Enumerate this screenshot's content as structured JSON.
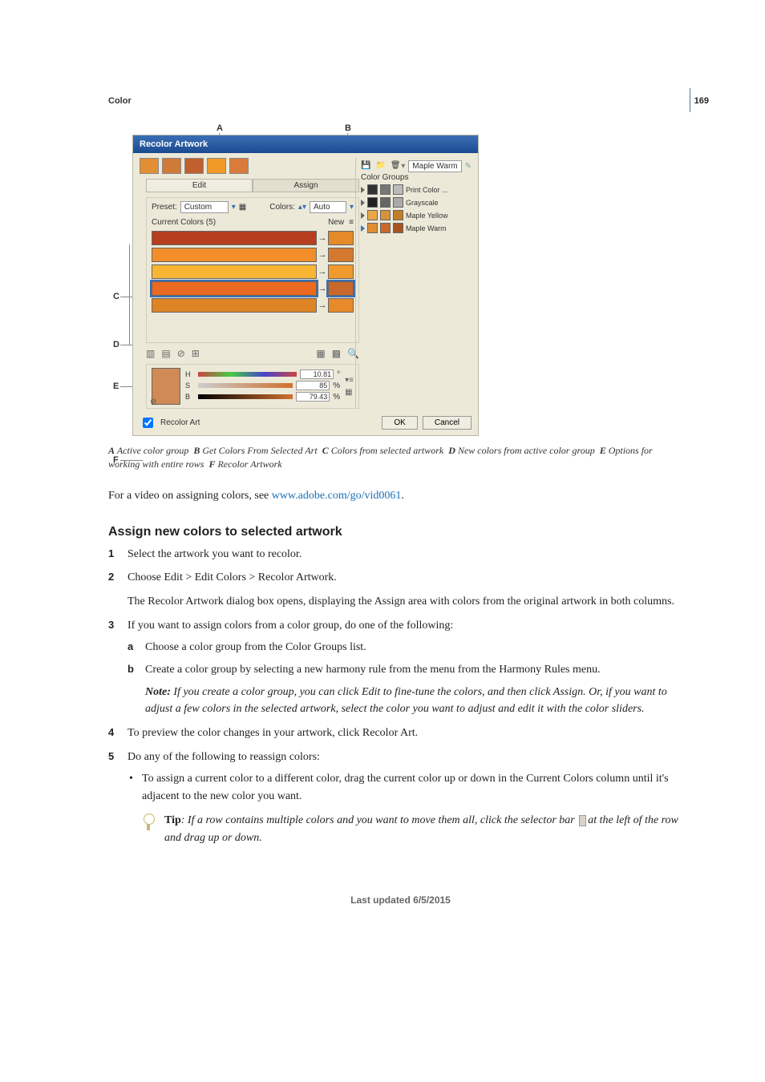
{
  "page_number": "169",
  "running_head": "Color",
  "screenshot": {
    "title": "Recolor Artwork",
    "preset_name": "Maple Warm",
    "color_groups_label": "Color Groups",
    "groups": [
      {
        "label": "Print Color ..."
      },
      {
        "label": "Grayscale"
      },
      {
        "label": "Maple Yellow"
      },
      {
        "label": "Maple Warm"
      }
    ],
    "tab_edit": "Edit",
    "tab_assign": "Assign",
    "preset_lbl": "Preset:",
    "preset_val": "Custom",
    "colors_lbl": "Colors:",
    "colors_val": "Auto",
    "current_colors": "Current Colors (5)",
    "new_label": "New",
    "hsb": {
      "h_lbl": "H",
      "s_lbl": "S",
      "b_lbl": "B",
      "h_val": "10.81",
      "s_val": "85",
      "b_val": "79.43",
      "s_unit": "%",
      "b_unit": "%",
      "h_unit": "°"
    },
    "recolor_art_chk": "Recolor Art",
    "ok": "OK",
    "cancel": "Cancel"
  },
  "callouts": {
    "A": "A",
    "B": "B",
    "C": "C",
    "D": "D",
    "E": "E",
    "F": "F"
  },
  "caption": {
    "A": "A",
    "A_txt": "Active color group",
    "B": "B",
    "B_txt": "Get Colors From Selected Art",
    "C": "C",
    "C_txt": "Colors from selected artwork",
    "D": "D",
    "D_txt": "New colors from active color group",
    "E": "E",
    "E_txt": "Options for working with entire rows",
    "F": "F",
    "F_txt": "Recolor Artwork"
  },
  "video_line": {
    "pre": "For a video on assigning colors, see ",
    "link": "www.adobe.com/go/vid0061",
    "post": "."
  },
  "heading": "Assign new colors to selected artwork",
  "steps": {
    "s1": "Select the artwork you want to recolor.",
    "s2": "Choose Edit > Edit Colors > Recolor Artwork.",
    "s2b": "The Recolor Artwork dialog box opens, displaying the Assign area with colors from the original artwork in both columns.",
    "s3": "If you want to assign colors from a color group, do one of the following:",
    "s3a": "Choose a color group from the Color Groups list.",
    "s3b": "Create a color group by selecting a new harmony rule from the menu from the Harmony Rules menu.",
    "s3note_lbl": "Note: ",
    "s3note": "If you create a color group, you can click Edit to fine-tune the colors, and then click Assign. Or, if you want to adjust a few colors in the selected artwork, select the color you want to adjust and edit it with the color sliders.",
    "s4": "To preview the color changes in your artwork, click Recolor Art.",
    "s5": "Do any of the following to reassign colors:",
    "s5a": "To assign a current color to a different color, drag the current color up or down in the Current Colors column until it's adjacent to the new color you want.",
    "s5tip_lbl": "Tip",
    "s5tip_pre": ": If a row contains multiple colors and you want to move them all, click the selector bar ",
    "s5tip_post": "at the left of the row and drag up or down."
  },
  "footer": "Last updated 6/5/2015"
}
